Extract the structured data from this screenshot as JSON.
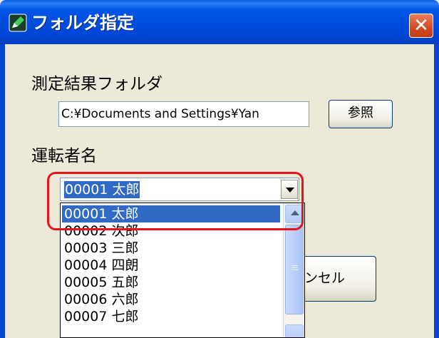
{
  "window": {
    "title": "フォルダ指定",
    "close_label": "✕"
  },
  "form": {
    "folder_label": "測定結果フォルダ",
    "folder_value": "C:¥Documents and Settings¥Yan",
    "browse_label": "参照",
    "driver_label": "運転者名",
    "driver_selected": "00001 太郎",
    "cancel_label_visible": "ンセル"
  },
  "dropdown": {
    "items": [
      "00001 太郎",
      "00002 次郎",
      "00003 三郎",
      "00004 四朗",
      "00005 五郎",
      "00006 六郎",
      "00007 七郎"
    ],
    "selected_index": 0
  },
  "colors": {
    "titlebar": "#0055e5",
    "selection": "#316ac5",
    "annotation": "#e8131a",
    "dialog_bg": "#ece9d8"
  },
  "icons": {
    "title_icon": "pencil-folder-icon",
    "close": "close-icon",
    "combo_arrow": "chevron-down-icon",
    "scroll_up": "chevron-up-icon"
  }
}
